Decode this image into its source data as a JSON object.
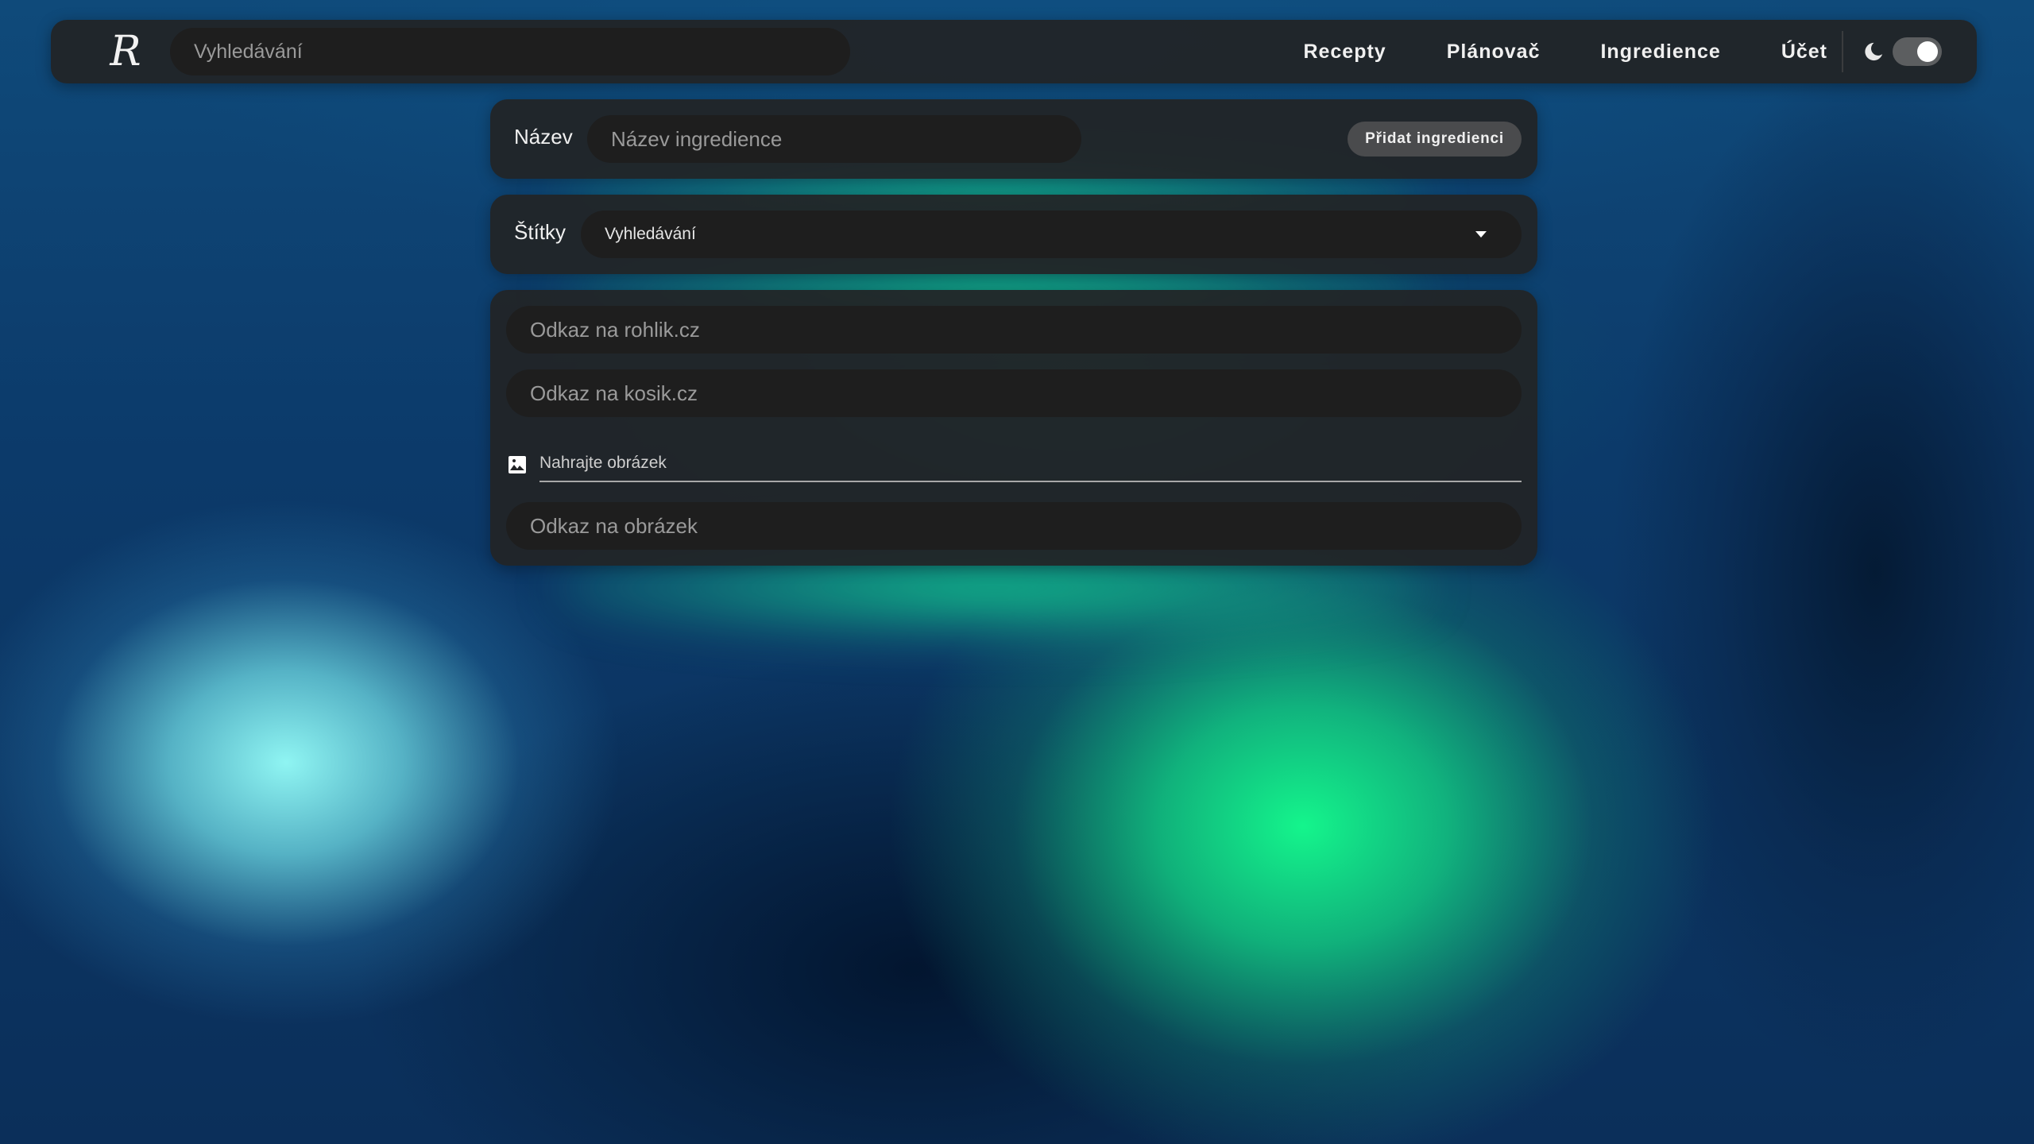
{
  "navbar": {
    "logo_text": "R",
    "search_placeholder": "Vyhledávání",
    "links": [
      "Recepty",
      "Plánovač",
      "Ingredience",
      "Účet"
    ],
    "theme_icon": "moon-icon",
    "dark_mode_on": true
  },
  "form": {
    "name_label": "Název",
    "name_placeholder": "Název ingredience",
    "add_button_label": "Přidat ingredienci",
    "tags_label": "Štítky",
    "tags_select_value": "Vyhledávání",
    "rohlik_placeholder": "Odkaz na rohlik.cz",
    "kosik_placeholder": "Odkaz na kosik.cz",
    "upload_label": "Nahrajte obrázek",
    "upload_icon": "image-icon",
    "image_url_placeholder": "Odkaz na obrázek"
  },
  "colors": {
    "panel": "#222426",
    "input": "#1e1e1e",
    "button": "#4a4b4d",
    "accent_green": "#14f58c",
    "accent_cyan": "#96fffa",
    "background": "#0d3563"
  }
}
